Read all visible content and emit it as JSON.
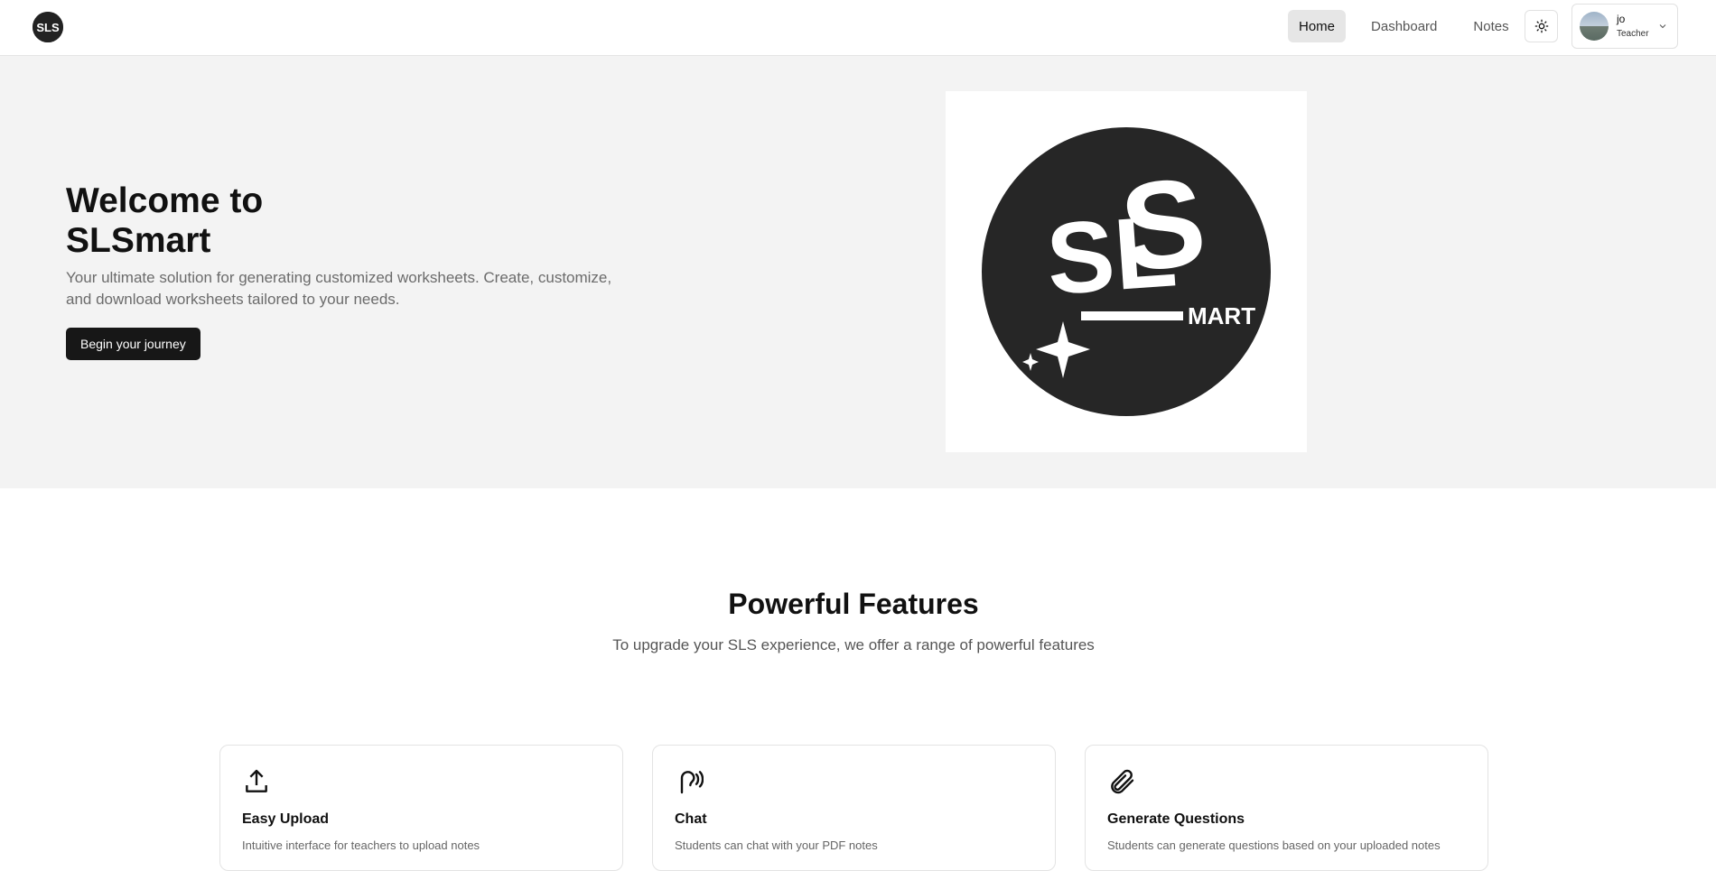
{
  "header": {
    "logo_alt": "SLS",
    "nav": [
      {
        "label": "Home",
        "active": true
      },
      {
        "label": "Dashboard",
        "active": false
      },
      {
        "label": "Notes",
        "active": false
      }
    ],
    "theme_icon": "sun-icon",
    "user": {
      "name": "jo",
      "role": "Teacher"
    }
  },
  "hero": {
    "title_line1": "Welcome to",
    "title_line2": "SLSmart",
    "subtitle": "Your ultimate solution for generating customized worksheets. Create, customize, and download worksheets tailored to your needs.",
    "cta": "Begin your journey",
    "logo_text_main": "SLS",
    "logo_text_suffix": "MART"
  },
  "features": {
    "title": "Powerful Features",
    "subtitle": "To upgrade your SLS experience, we offer a range of powerful features",
    "cards": [
      {
        "icon": "upload-icon",
        "title": "Easy Upload",
        "desc": "Intuitive interface for teachers to upload notes"
      },
      {
        "icon": "chat-audio-icon",
        "title": "Chat",
        "desc": "Students can chat with your PDF notes"
      },
      {
        "icon": "paperclip-icon",
        "title": "Generate Questions",
        "desc": "Students can generate questions based on your uploaded notes"
      }
    ]
  },
  "colors": {
    "accent": "#171717",
    "hero_bg": "#f3f3f3",
    "logo_dark": "#262626"
  }
}
